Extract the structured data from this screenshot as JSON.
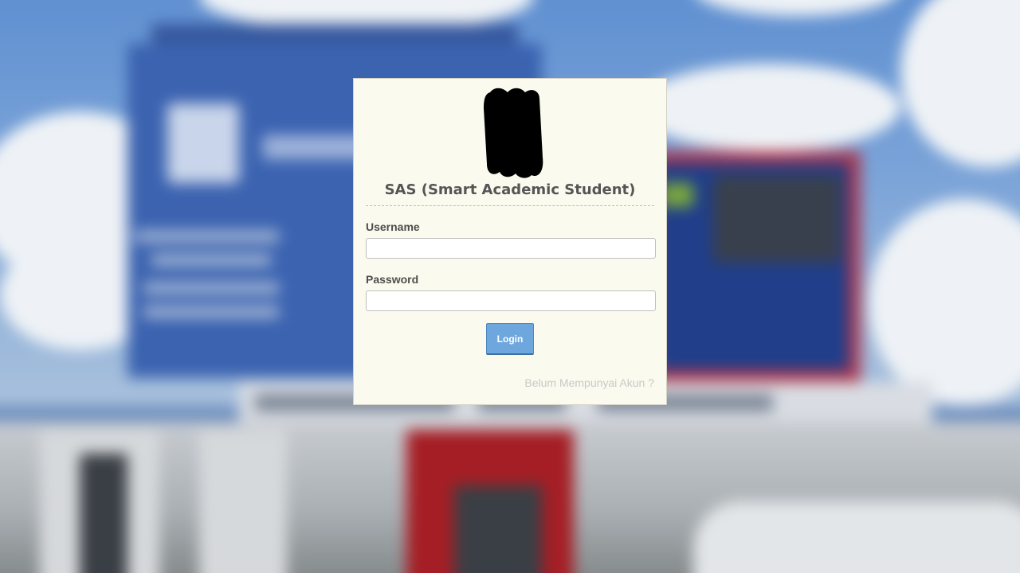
{
  "login": {
    "title": "SAS (Smart Academic Student)",
    "username_label": "Username",
    "username_value": "",
    "password_label": "Password",
    "password_value": "",
    "login_button": "Login",
    "register_link": "Belum Mempunyai Akun ?"
  },
  "icons": {
    "logo": "redacted-logo-icon"
  },
  "colors": {
    "panel_background": "#fbfaee",
    "button_background": "#6ea7dd",
    "title_text": "#555555",
    "link_text": "#c9c9c9"
  }
}
